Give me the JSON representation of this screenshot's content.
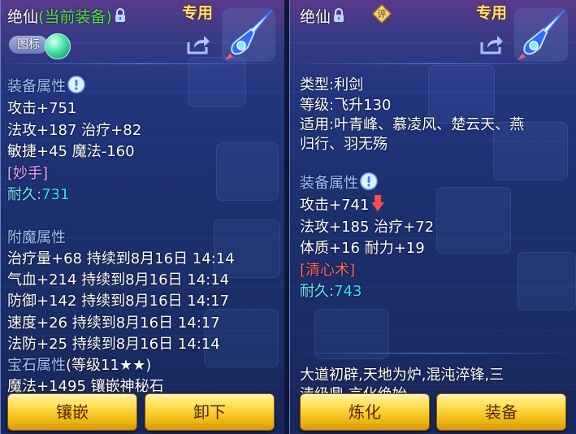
{
  "left": {
    "title": "绝仙",
    "equipped_tag": "(当前装备)",
    "special": "专用",
    "icon_button": "图标",
    "attr_header": "装备属性",
    "attrs": [
      "攻击+751",
      "法攻+187 治疗+82",
      "敏捷+45 魔法-160"
    ],
    "skill": "[妙手]",
    "durability_label": "耐久:",
    "durability_value": "731",
    "enchant_header": "附魔属性",
    "enchants": [
      "治疗量+68 持续到8月16日 14:14",
      "气血+214 持续到8月16日 14:14",
      "防御+142 持续到8月16日 14:17",
      "速度+26 持续到8月16日 14:17",
      "法防+25 持续到8月16日 14:14"
    ],
    "gem_header": "宝石属性",
    "gem_level": "(等级11★★)",
    "gem_line": "魔法+1495 镶嵌神秘石",
    "buttons": {
      "inlay": "镶嵌",
      "unequip": "卸下"
    }
  },
  "right": {
    "title": "绝仙",
    "eval_badge": "评",
    "special": "专用",
    "type_line": "类型:利剑",
    "level_line": "等级:飞升130",
    "suit_line1": "适用:叶青峰、慕凌风、楚云天、燕",
    "suit_line2": "归行、羽无殇",
    "attr_header": "装备属性",
    "attrs": [
      "攻击+741",
      "法攻+185 治疗+72",
      "体质+16 耐力+19"
    ],
    "skill": "[清心术]",
    "durability_label": "耐久:",
    "durability_value": "743",
    "desc_line1": "大道初辟,天地为炉,混沌淬锋,三",
    "desc_line2": "清级鼎,言化绝始",
    "buttons": {
      "refine": "炼化",
      "equip": "装备"
    }
  },
  "icons": [
    "lock-icon",
    "info-icon",
    "share-icon",
    "sword-icon",
    "orb-icon",
    "down-arrow-icon",
    "eval-badge-icon"
  ],
  "colors": {
    "equipped": "#4fe84f",
    "special": "#ffe27a",
    "header": "#9ec3ff",
    "skill_left": "#e9a8ff",
    "skill_right": "#ff6a6a",
    "durability": "#2ee3ff",
    "button": "#f4c21c"
  }
}
